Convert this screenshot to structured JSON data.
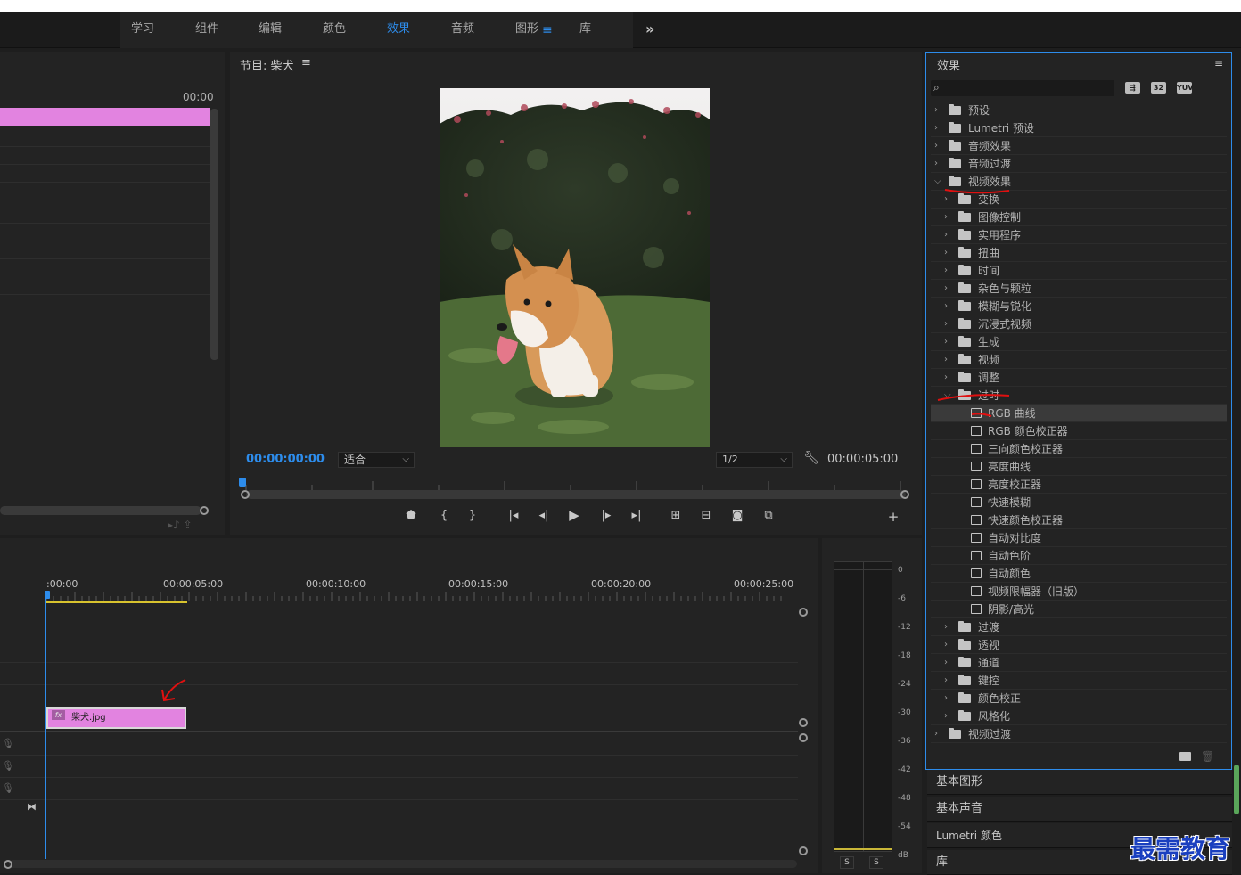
{
  "workspace": {
    "tabs": [
      "学习",
      "组件",
      "编辑",
      "颜色",
      "效果",
      "音频",
      "图形",
      "库"
    ],
    "active_tab": "效果",
    "more": "»"
  },
  "source": {
    "timecode": "00:00"
  },
  "program": {
    "title": "节目: 柴犬",
    "menu": "≡",
    "timecode": "00:00:00:00",
    "fit": "适合",
    "resolution": "1/2",
    "duration": "00:00:05:00"
  },
  "effects": {
    "title": "效果",
    "menu": "≡",
    "badges": [
      "32",
      "YUV"
    ],
    "tree": [
      {
        "label": "预设",
        "level": 0,
        "kind": "folder-star",
        "open": false
      },
      {
        "label": "Lumetri 预设",
        "level": 0,
        "kind": "folder-star",
        "open": false
      },
      {
        "label": "音频效果",
        "level": 0,
        "kind": "folder",
        "open": false
      },
      {
        "label": "音频过渡",
        "level": 0,
        "kind": "folder",
        "open": false
      },
      {
        "label": "视频效果",
        "level": 0,
        "kind": "folder",
        "open": true
      },
      {
        "label": "变换",
        "level": 1,
        "kind": "folder",
        "open": false
      },
      {
        "label": "图像控制",
        "level": 1,
        "kind": "folder",
        "open": false
      },
      {
        "label": "实用程序",
        "level": 1,
        "kind": "folder",
        "open": false
      },
      {
        "label": "扭曲",
        "level": 1,
        "kind": "folder",
        "open": false
      },
      {
        "label": "时间",
        "level": 1,
        "kind": "folder",
        "open": false
      },
      {
        "label": "杂色与颗粒",
        "level": 1,
        "kind": "folder",
        "open": false
      },
      {
        "label": "模糊与锐化",
        "level": 1,
        "kind": "folder",
        "open": false
      },
      {
        "label": "沉浸式视频",
        "level": 1,
        "kind": "folder",
        "open": false
      },
      {
        "label": "生成",
        "level": 1,
        "kind": "folder",
        "open": false
      },
      {
        "label": "视频",
        "level": 1,
        "kind": "folder",
        "open": false
      },
      {
        "label": "调整",
        "level": 1,
        "kind": "folder",
        "open": false
      },
      {
        "label": "过时",
        "level": 1,
        "kind": "folder",
        "open": true
      },
      {
        "label": "RGB 曲线",
        "level": 2,
        "kind": "effect",
        "selected": true
      },
      {
        "label": "RGB 颜色校正器",
        "level": 2,
        "kind": "effect"
      },
      {
        "label": "三向颜色校正器",
        "level": 2,
        "kind": "effect"
      },
      {
        "label": "亮度曲线",
        "level": 2,
        "kind": "effect"
      },
      {
        "label": "亮度校正器",
        "level": 2,
        "kind": "effect"
      },
      {
        "label": "快速模糊",
        "level": 2,
        "kind": "effect"
      },
      {
        "label": "快速颜色校正器",
        "level": 2,
        "kind": "effect"
      },
      {
        "label": "自动对比度",
        "level": 2,
        "kind": "effect"
      },
      {
        "label": "自动色阶",
        "level": 2,
        "kind": "effect"
      },
      {
        "label": "自动颜色",
        "level": 2,
        "kind": "effect"
      },
      {
        "label": "视频限幅器（旧版）",
        "level": 2,
        "kind": "effect"
      },
      {
        "label": "阴影/高光",
        "level": 2,
        "kind": "effect"
      },
      {
        "label": "过渡",
        "level": 1,
        "kind": "folder",
        "open": false
      },
      {
        "label": "透视",
        "level": 1,
        "kind": "folder",
        "open": false
      },
      {
        "label": "通道",
        "level": 1,
        "kind": "folder",
        "open": false
      },
      {
        "label": "键控",
        "level": 1,
        "kind": "folder",
        "open": false
      },
      {
        "label": "颜色校正",
        "level": 1,
        "kind": "folder",
        "open": false
      },
      {
        "label": "风格化",
        "level": 1,
        "kind": "folder",
        "open": false
      },
      {
        "label": "视频过渡",
        "level": 0,
        "kind": "folder",
        "open": false
      }
    ]
  },
  "side_panels": [
    "基本图形",
    "基本声音",
    "Lumetri 颜色",
    "库"
  ],
  "timeline": {
    "timecodes": [
      ":00:00",
      "00:00:05:00",
      "00:00:10:00",
      "00:00:15:00",
      "00:00:20:00",
      "00:00:25:00"
    ],
    "clip": {
      "name": "柴犬.jpg",
      "fx": "fx"
    }
  },
  "meter": {
    "db_labels": [
      "0",
      "-6",
      "-12",
      "-18",
      "-24",
      "-30",
      "-36",
      "-42",
      "-48",
      "-54",
      "dB"
    ],
    "solo": [
      "S",
      "S"
    ]
  },
  "watermark": "最需教育",
  "colors": {
    "accent": "#2d8ceb",
    "clip": "#e283e0",
    "annotation": "#e01010"
  }
}
